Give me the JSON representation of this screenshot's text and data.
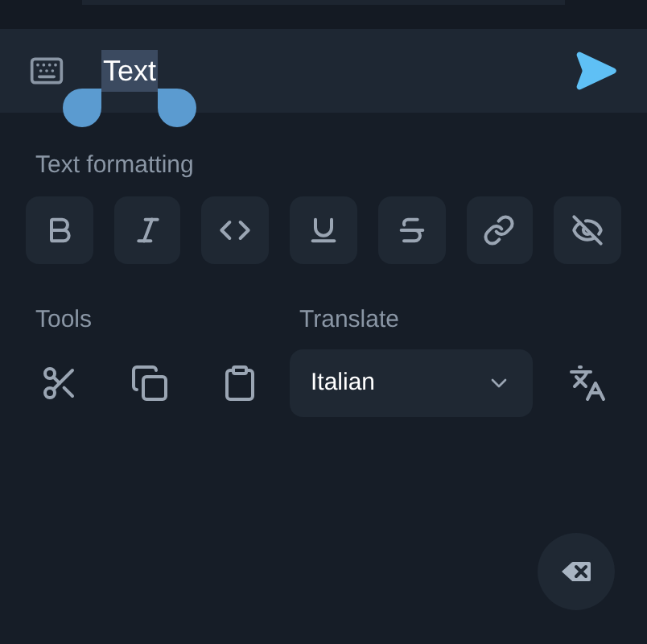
{
  "input": {
    "value": "Text",
    "selected": true
  },
  "formatting": {
    "title": "Text formatting",
    "buttons": [
      {
        "kind": "bold"
      },
      {
        "kind": "italic"
      },
      {
        "kind": "code"
      },
      {
        "kind": "underline"
      },
      {
        "kind": "strikethrough"
      },
      {
        "kind": "link"
      },
      {
        "kind": "spoiler"
      }
    ]
  },
  "tools": {
    "title": "Tools",
    "buttons": [
      {
        "kind": "cut"
      },
      {
        "kind": "copy"
      },
      {
        "kind": "paste"
      }
    ]
  },
  "translate": {
    "title": "Translate",
    "language": "Italian"
  }
}
